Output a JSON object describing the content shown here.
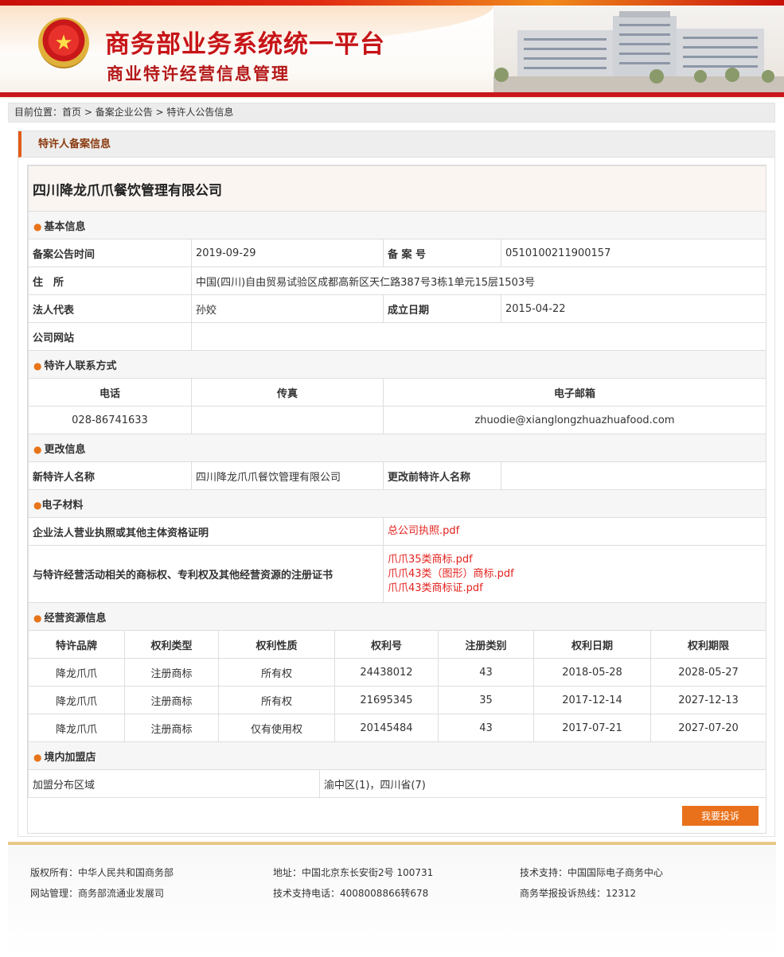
{
  "header": {
    "title": "商务部业务系统统一平台",
    "subtitle": "商业特许经营信息管理"
  },
  "breadcrumb": {
    "label": "目前位置：",
    "items": [
      "首页",
      "备案企业公告",
      "特许人公告信息"
    ],
    "separator": " > "
  },
  "panel": {
    "title": "特许人备案信息"
  },
  "company_name": "四川降龙爪爪餐饮管理有限公司",
  "basic": {
    "section": "基本信息",
    "announce_time_label": "备案公告时间",
    "announce_time": "2019-09-29",
    "record_no_label": "备 案 号",
    "record_no": "0510100211900157",
    "address_label": "住　所",
    "address": "中国(四川)自由贸易试验区成都高新区天仁路387号3栋1单元15层1503号",
    "legal_rep_label": "法人代表",
    "legal_rep": "孙姣",
    "established_label": "成立日期",
    "established": "2015-04-22",
    "website_label": "公司网站",
    "website": ""
  },
  "contact": {
    "section": "特许人联系方式",
    "headers": [
      "电话",
      "传真",
      "电子邮箱"
    ],
    "phone": "028-86741633",
    "fax": "",
    "email": "zhuodie@xianglongzhuazhuafood.com"
  },
  "change": {
    "section": "更改信息",
    "new_name_label": "新特许人名称",
    "new_name": "四川降龙爪爪餐饮管理有限公司",
    "old_name_label": "更改前特许人名称",
    "old_name": ""
  },
  "materials": {
    "section": "电子材料",
    "license_label": "企业法人营业执照或其他主体资格证明",
    "license_files": [
      "总公司执照.pdf"
    ],
    "trademark_label": "与特许经营活动相关的商标权、专利权及其他经营资源的注册证书",
    "trademark_files": [
      "爪爪35类商标.pdf",
      "爪爪43类（图形）商标.pdf",
      "爪爪43类商标证.pdf"
    ]
  },
  "resources": {
    "section": "经营资源信息",
    "headers": [
      "特许品牌",
      "权利类型",
      "权利性质",
      "权利号",
      "注册类别",
      "权利日期",
      "权利期限"
    ],
    "rows": [
      [
        "降龙爪爪",
        "注册商标",
        "所有权",
        "24438012",
        "43",
        "2018-05-28",
        "2028-05-27"
      ],
      [
        "降龙爪爪",
        "注册商标",
        "所有权",
        "21695345",
        "35",
        "2017-12-14",
        "2027-12-13"
      ],
      [
        "降龙爪爪",
        "注册商标",
        "仅有使用权",
        "20145484",
        "43",
        "2017-07-21",
        "2027-07-20"
      ]
    ]
  },
  "stores": {
    "section": "境内加盟店",
    "area_label": "加盟分布区域",
    "area": "渝中区(1)，四川省(7)"
  },
  "complain_button": "我要投诉",
  "footer": {
    "copyright": "版权所有：中华人民共和国商务部",
    "address": "地址：中国北京东长安街2号 100731",
    "tech_support": "技术支持：中国国际电子商务中心",
    "site_admin": "网站管理：商务部流通业发展司",
    "tech_phone": "技术支持电话：4008008866转678",
    "hotline": "商务举报投诉热线：12312"
  },
  "colors": {
    "brand_red": "#c71417",
    "accent_orange": "#e9711b",
    "link_red": "#e3221e"
  }
}
